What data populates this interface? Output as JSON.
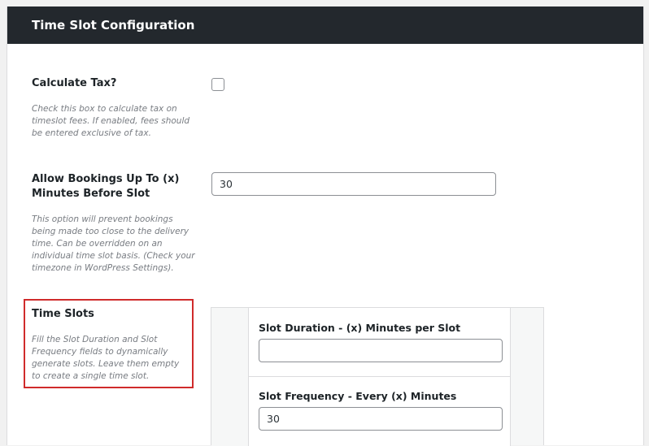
{
  "header": {
    "title": "Time Slot Configuration"
  },
  "fields": {
    "calculate_tax": {
      "label": "Calculate Tax?",
      "description": "Check this box to calculate tax on timeslot fees. If enabled, fees should be entered exclusive of tax.",
      "checked": false
    },
    "allow_bookings": {
      "label": "Allow Bookings Up To (x) Minutes Before Slot",
      "value": "30",
      "description": "This option will prevent bookings being made too close to the delivery time. Can be overridden on an individual time slot basis. (Check your timezone in WordPress Settings)."
    },
    "time_slots": {
      "label": "Time Slots",
      "description": "Fill the Slot Duration and Slot Frequency fields to dynamically generate slots. Leave them empty to create a single time slot.",
      "highlight_color": "#d02b2b",
      "slot_duration": {
        "label": "Slot Duration - (x) Minutes per Slot",
        "value": ""
      },
      "slot_frequency": {
        "label": "Slot Frequency - Every (x) Minutes",
        "value": "30"
      }
    }
  },
  "colors": {
    "header_bg": "#23282d",
    "page_bg": "#f1f1f1",
    "description_text": "#787c82"
  }
}
